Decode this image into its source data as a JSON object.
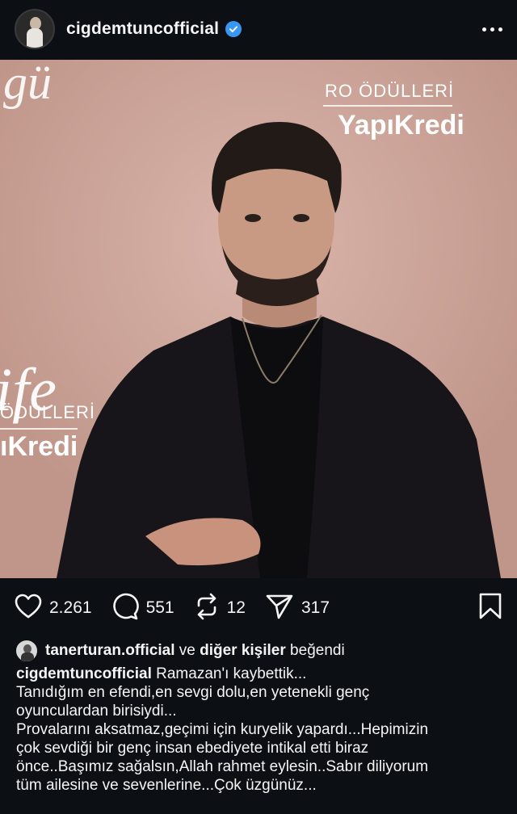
{
  "header": {
    "username": "cigdemtuncofficial",
    "avatar_icon": "profile-avatar",
    "verified_icon": "verified-badge-icon",
    "more_icon": "more-options-icon"
  },
  "photo": {
    "wall_script_top": "gü",
    "wall_awards_top": "RO ÖDÜLLERİ",
    "wall_bank_top": "YapıKredi",
    "wall_script_left": "ife",
    "wall_awards_left": "ÖDÜLLERİ",
    "wall_bank_left": "ıKredi"
  },
  "actions": {
    "likes": "2.261",
    "comments": "551",
    "reposts": "12",
    "shares": "317"
  },
  "liked_by": {
    "user": "tanerturan.official",
    "connector": " ve ",
    "others": "diğer kişiler",
    "suffix": " beğendi"
  },
  "caption": {
    "author": "cigdemtuncofficial",
    "line1": " Ramazan'ı kaybettik...",
    "line2": "Tanıdığım en efendi,en sevgi dolu,en yetenekli genç\noyunculardan birisiydi...",
    "line3": "Provalarını aksatmaz,geçimi için kuryelik yapardı...Hepimizin\nçok sevdiği bir genç insan ebediyete intikal etti biraz\nönce..Başımız sağalsın,Allah rahmet eylesin..Sabır diliyorum\ntüm ailesine ve sevenlerine...Çok üzgünüz..."
  },
  "colors": {
    "background": "#0c0f14",
    "text": "#f5f5f5",
    "verified": "#3897f0",
    "photo_wall": "#cfa79c"
  }
}
